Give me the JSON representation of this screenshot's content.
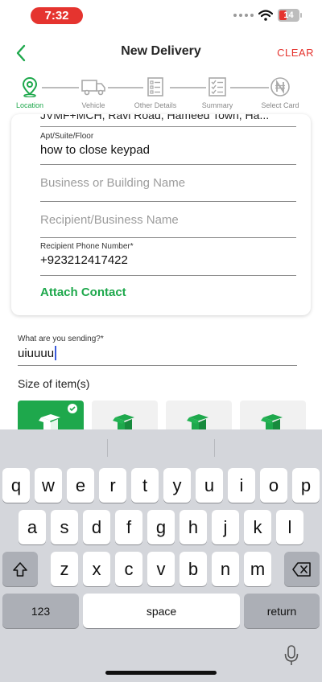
{
  "status": {
    "time": "7:32",
    "battery": "14"
  },
  "header": {
    "title": "New Delivery",
    "clear_label": "CLEAR"
  },
  "steps": [
    {
      "label": "Location",
      "icon": "location-pin-icon",
      "active": true
    },
    {
      "label": "Vehicle",
      "icon": "truck-icon",
      "active": false
    },
    {
      "label": "Other Details",
      "icon": "details-list-icon",
      "active": false
    },
    {
      "label": "Summary",
      "icon": "checklist-icon",
      "active": false
    },
    {
      "label": "Select Card",
      "icon": "naira-coin-icon",
      "active": false
    }
  ],
  "form": {
    "address_partial": "JVMF+MCH, Ravi Road, Hameed Town, Ha...",
    "apt_label": "Apt/Suite/Floor",
    "apt_value": "how to close keypad",
    "business_placeholder": "Business or Building Name",
    "recipient_placeholder": "Recipient/Business Name",
    "phone_label": "Recipient Phone Number*",
    "phone_value": "+923212417422",
    "attach_label": "Attach Contact",
    "sending_label": "What are you sending?*",
    "sending_value": "uiuuuu",
    "size_title": "Size of item(s)"
  },
  "keyboard": {
    "row1": [
      "q",
      "w",
      "e",
      "r",
      "t",
      "y",
      "u",
      "i",
      "o",
      "p"
    ],
    "row2": [
      "a",
      "s",
      "d",
      "f",
      "g",
      "h",
      "j",
      "k",
      "l"
    ],
    "row3": [
      "z",
      "x",
      "c",
      "v",
      "b",
      "n",
      "m"
    ],
    "numbers_label": "123",
    "space_label": "space",
    "return_label": "return"
  },
  "colors": {
    "brand_green": "#1ea84c",
    "clear_red": "#e5342f"
  }
}
